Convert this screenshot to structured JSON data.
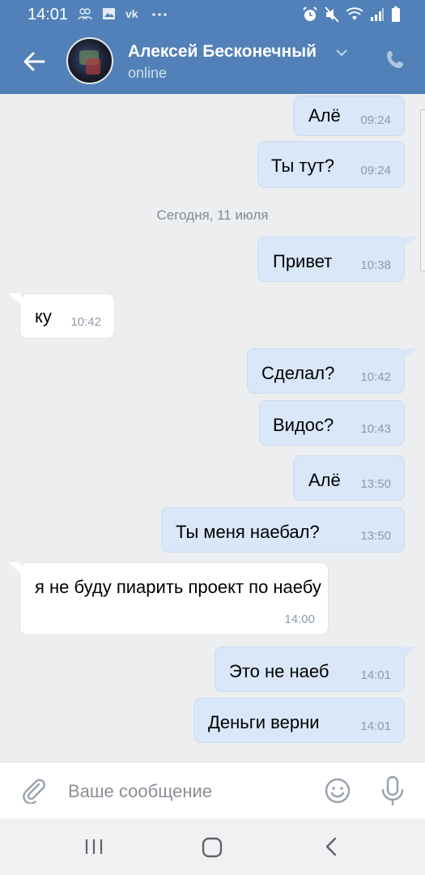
{
  "status_bar": {
    "time": "14:01",
    "left_icons": [
      "people-icon",
      "image-icon",
      "vk-icon",
      "more-icon"
    ],
    "right_icons": [
      "alarm-icon",
      "mute-icon",
      "wifi-icon",
      "signal-icon",
      "battery-icon"
    ]
  },
  "header": {
    "contact_name": "Алексей Бесконечный",
    "status": "online",
    "icons": [
      "back-arrow-icon",
      "avatar",
      "chevron-down-icon",
      "phone-icon"
    ]
  },
  "messages": [
    {
      "dir": "out",
      "text": "Алё",
      "time": "09:24"
    },
    {
      "dir": "out",
      "text": "Ты тут?",
      "time": "09:24"
    },
    {
      "type": "date",
      "text": "Сегодня, 11 июля"
    },
    {
      "dir": "out",
      "text": "Привет",
      "time": "10:38"
    },
    {
      "dir": "in",
      "text": "ку",
      "time": "10:42"
    },
    {
      "dir": "out",
      "text": "Сделал?",
      "time": "10:42"
    },
    {
      "dir": "out",
      "text": "Видос?",
      "time": "10:43"
    },
    {
      "dir": "out",
      "text": "Алё",
      "time": "13:50"
    },
    {
      "dir": "out",
      "text": "Ты меня наебал?",
      "time": "13:50"
    },
    {
      "dir": "in",
      "text": "я не буду пиарить проект по наебу",
      "time": "14:00"
    },
    {
      "dir": "out",
      "text": "Это не наеб",
      "time": "14:01"
    },
    {
      "dir": "out",
      "text": "Деньги верни",
      "time": "14:01"
    }
  ],
  "composer": {
    "placeholder": "Ваше сообщение",
    "icons": [
      "attach-icon",
      "emoji-icon",
      "microphone-icon"
    ]
  },
  "nav_bar": {
    "icons": [
      "recent-apps-icon",
      "home-icon",
      "back-icon"
    ]
  },
  "colors": {
    "header": "#5181b8",
    "background": "#edeef0",
    "bubble_out": "#d9e7f9",
    "bubble_in": "#ffffff",
    "time_text": "#8f9aa8"
  }
}
